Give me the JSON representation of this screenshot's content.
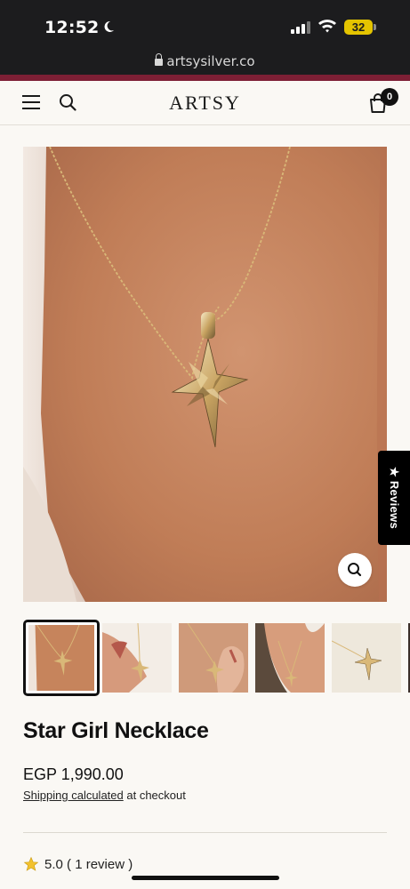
{
  "status_bar": {
    "time": "12:52",
    "battery_level": "32"
  },
  "browser": {
    "url": "artsysilver.co"
  },
  "header": {
    "brand": "ARTSY",
    "cart_count": "0"
  },
  "reviews_tab": {
    "label": "★ Reviews"
  },
  "product": {
    "title": "Star Girl Necklace",
    "price": "EGP 1,990.00",
    "shipping_link": "Shipping calculated",
    "shipping_suffix": " at checkout",
    "rating": "5.0",
    "review_count": "( 1 review )"
  },
  "gallery": {
    "image_count": 6,
    "selected_index": 0
  },
  "colors": {
    "accent_strip": "#7d1f35",
    "background": "#faf8f4",
    "brand_text": "#1a1a1a",
    "skin": "#c6845c",
    "gold": "#d9b878"
  }
}
